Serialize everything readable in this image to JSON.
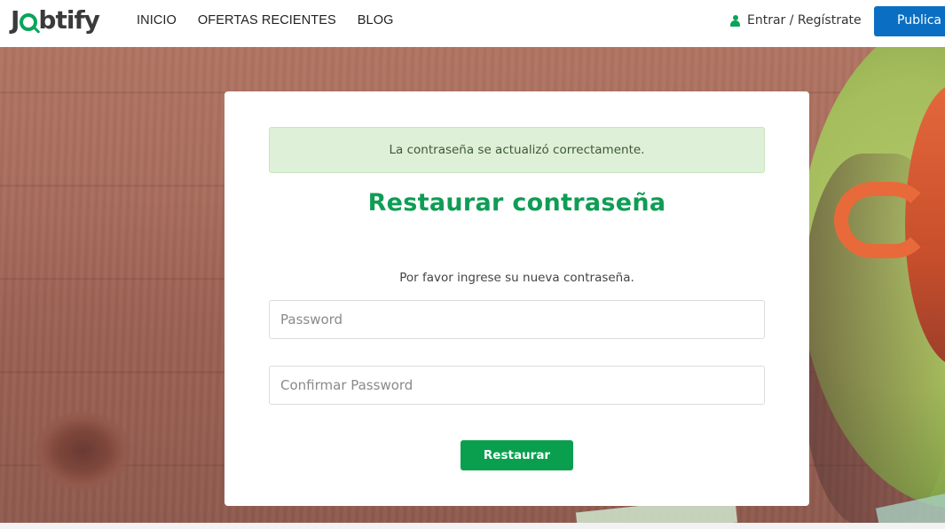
{
  "brand": {
    "logo_left": "J",
    "logo_right": "btify"
  },
  "nav": {
    "links": [
      "INICIO",
      "OFERTAS RECIENTES",
      "BLOG"
    ],
    "login_label": "Entrar / Regístrate",
    "publish_label": "Publica una oferta"
  },
  "alert": {
    "message": "La contraseña se actualizó correctamente."
  },
  "form": {
    "title": "Restaurar contraseña",
    "subtitle": "Por favor ingrese su nueva contraseña.",
    "password_placeholder": "Password",
    "confirm_placeholder": "Confirmar Password",
    "submit_label": "Restaurar"
  },
  "colors": {
    "accent_green": "#0f9d55",
    "button_green": "#0a9f4f",
    "publish_blue": "#0a6fc2",
    "alert_bg": "#dff0d8"
  },
  "icons": {
    "login": "user-icon",
    "logo": "magnifier-logo-icon"
  }
}
